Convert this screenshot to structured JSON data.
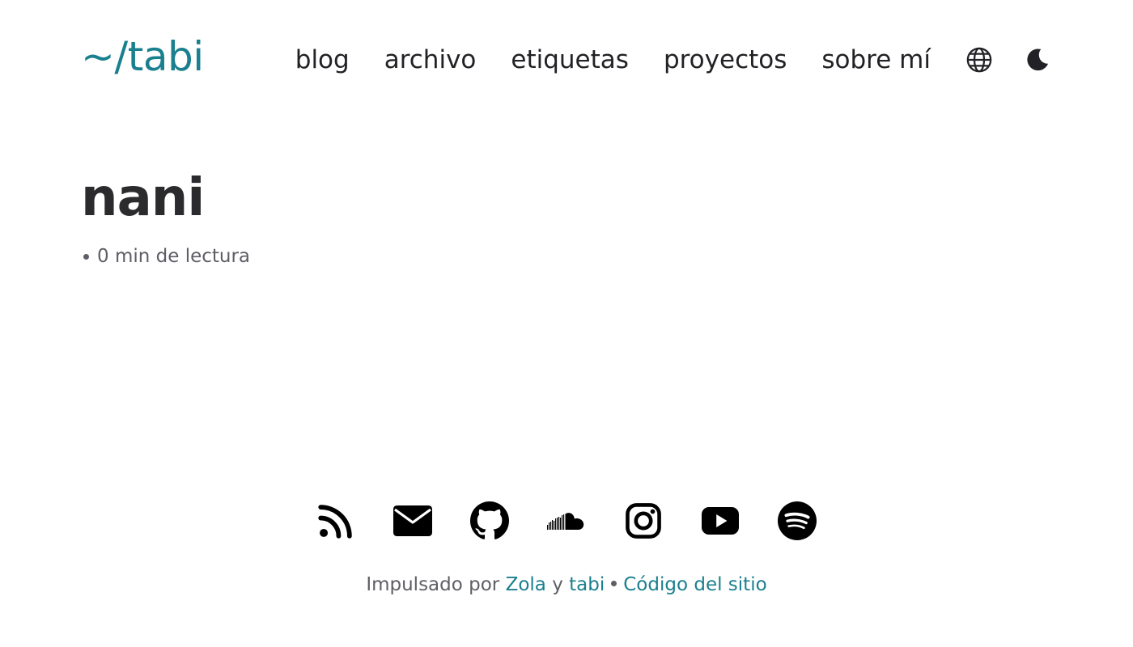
{
  "header": {
    "site_title": "~/tabi",
    "nav": [
      {
        "label": "blog"
      },
      {
        "label": "archivo"
      },
      {
        "label": "etiquetas"
      },
      {
        "label": "proyectos"
      },
      {
        "label": "sobre mí"
      }
    ],
    "icons": [
      "globe-icon",
      "moon-icon"
    ]
  },
  "post": {
    "title": "nani",
    "reading_time": "0 min de lectura"
  },
  "footer": {
    "social_icons": [
      "rss-icon",
      "email-icon",
      "github-icon",
      "soundcloud-icon",
      "instagram-icon",
      "youtube-icon",
      "spotify-icon"
    ],
    "powered_prefix": "Impulsado por",
    "zola_label": "Zola",
    "conjunction": "y",
    "tabi_label": "tabi",
    "source_label": "Código del sitio"
  },
  "colors": {
    "accent": "#1a7f8e",
    "text": "#222226",
    "muted": "#5e5e66",
    "background": "#ffffff"
  }
}
